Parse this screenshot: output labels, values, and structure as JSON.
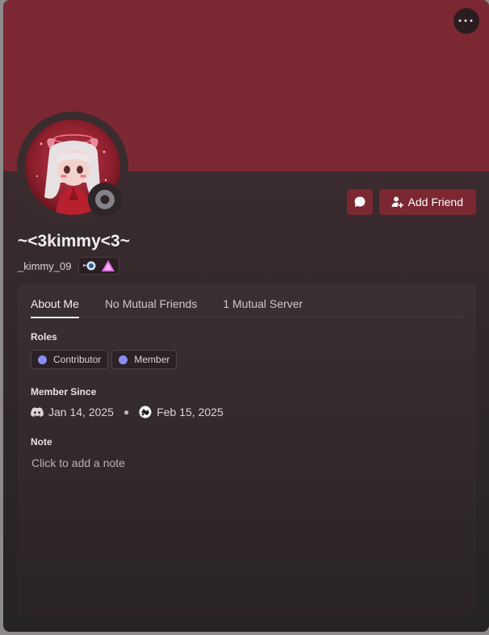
{
  "profile": {
    "display_name": "~<3kimmy<3~",
    "username": "_kimmy_09",
    "more_label": "···",
    "add_friend_label": "Add Friend",
    "badges": [
      "hypesquad-balance-icon",
      "triangle-gem-icon"
    ],
    "status": "offline",
    "banner_color": "#7b2832"
  },
  "tabs": [
    {
      "label": "About Me",
      "active": true
    },
    {
      "label": "No Mutual Friends",
      "active": false
    },
    {
      "label": "1 Mutual Server",
      "active": false
    }
  ],
  "about": {
    "roles_title": "Roles",
    "roles": [
      {
        "label": "Contributor",
        "color": "#8b8cf0"
      },
      {
        "label": "Member",
        "color": "#8b8cf0"
      }
    ],
    "member_since_title": "Member Since",
    "discord_since": "Jan 14, 2025",
    "server_since": "Feb 15, 2025",
    "note_title": "Note",
    "note_placeholder": "Click to add a note"
  }
}
